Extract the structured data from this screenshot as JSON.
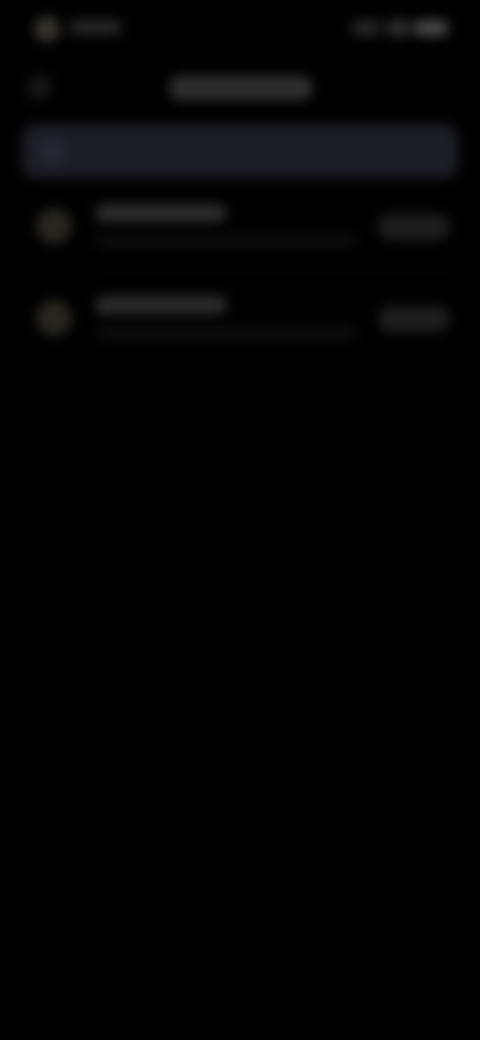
{
  "theme": {
    "background": "#000000",
    "search_bar_color": "#1b1e27"
  },
  "status_bar": {
    "time": "",
    "icons": [
      "signal-icon",
      "wifi-icon",
      "battery-icon"
    ]
  },
  "header": {
    "title": "",
    "back_icon": "back-arrow-icon"
  },
  "search": {
    "placeholder": "",
    "icon": "search-icon"
  },
  "list": {
    "items": [
      {
        "icon": "item-icon",
        "title": "",
        "subtitle": "",
        "action_label": ""
      },
      {
        "icon": "item-icon",
        "title": "",
        "subtitle": "",
        "action_label": ""
      }
    ]
  }
}
